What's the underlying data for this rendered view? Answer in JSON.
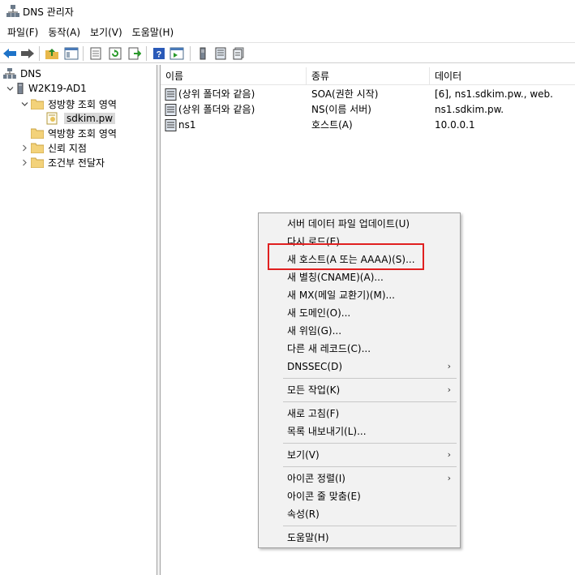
{
  "window": {
    "title": "DNS 관리자"
  },
  "menubar": {
    "items": [
      "파일(F)",
      "동작(A)",
      "보기(V)",
      "도움말(H)"
    ]
  },
  "toolbar": {
    "buttons": [
      "back-arrow-icon",
      "forward-arrow-icon",
      "up-folder-icon",
      "show-hide-tree-icon",
      "properties-icon",
      "refresh-icon",
      "export-icon",
      "help-icon",
      "action-pane-icon",
      "server-icon",
      "record-icon",
      "records-icon"
    ]
  },
  "tree": {
    "root": "DNS",
    "server": "W2K19-AD1",
    "forward_zones": "정방향 조회 영역",
    "zone": "sdkim.pw",
    "reverse_zones": "역방향 조회 영역",
    "trust_points": "신뢰 지점",
    "conditional_forwarders": "조건부 전달자"
  },
  "list": {
    "columns": [
      "이름",
      "종류",
      "데이터"
    ],
    "rows": [
      {
        "name": "(상위 폴더와 같음)",
        "type": "SOA(권한 시작)",
        "data": "[6], ns1.sdkim.pw., web."
      },
      {
        "name": "(상위 폴더와 같음)",
        "type": "NS(이름 서버)",
        "data": "ns1.sdkim.pw."
      },
      {
        "name": "ns1",
        "type": "호스트(A)",
        "data": "10.0.0.1"
      }
    ]
  },
  "context_menu": {
    "update_server_data": "서버 데이터 파일 업데이트(U)",
    "reload": "다시 로드(E)",
    "new_host": "새 호스트(A 또는 AAAA)(S)...",
    "new_alias": "새 별칭(CNAME)(A)...",
    "new_mx": "새 MX(메일 교환기)(M)...",
    "new_domain": "새 도메인(O)...",
    "new_delegation": "새 위임(G)...",
    "other_records": "다른 새 레코드(C)...",
    "dnssec": "DNSSEC(D)",
    "all_tasks": "모든 작업(K)",
    "refresh": "새로 고침(F)",
    "export_list": "목록 내보내기(L)...",
    "view": "보기(V)",
    "arrange_icons": "아이콘 정렬(I)",
    "line_up_icons": "아이콘 줄 맞춤(E)",
    "properties": "속성(R)",
    "help": "도움말(H)",
    "submenu_arrow": "›"
  },
  "colors": {
    "highlight": "#e02020",
    "back_arrow": "#1e73c8",
    "forward_arrow": "#555555",
    "folder": "#f3d27a"
  }
}
